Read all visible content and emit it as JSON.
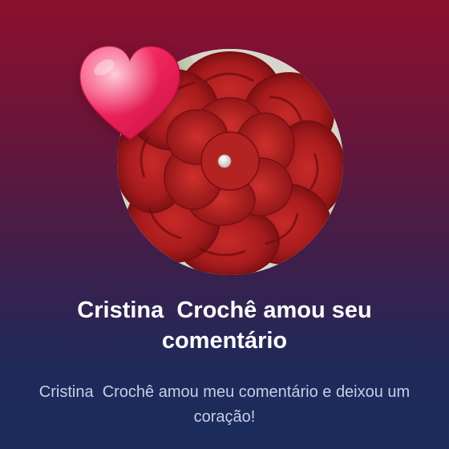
{
  "notification": {
    "title": "Cristina  Crochê amou seu comentário",
    "message": "Cristina  Crochê amou meu comentário e deixou um coração!"
  },
  "icons": {
    "reaction": "heart-icon",
    "avatar": "profile-avatar"
  },
  "colors": {
    "background_top": "#8c0f2e",
    "background_bottom": "#1b2c5c",
    "title_text": "#ffffff",
    "message_text": "#c8cde6",
    "heart": "#f0245e",
    "flower": "#b01d1f"
  }
}
